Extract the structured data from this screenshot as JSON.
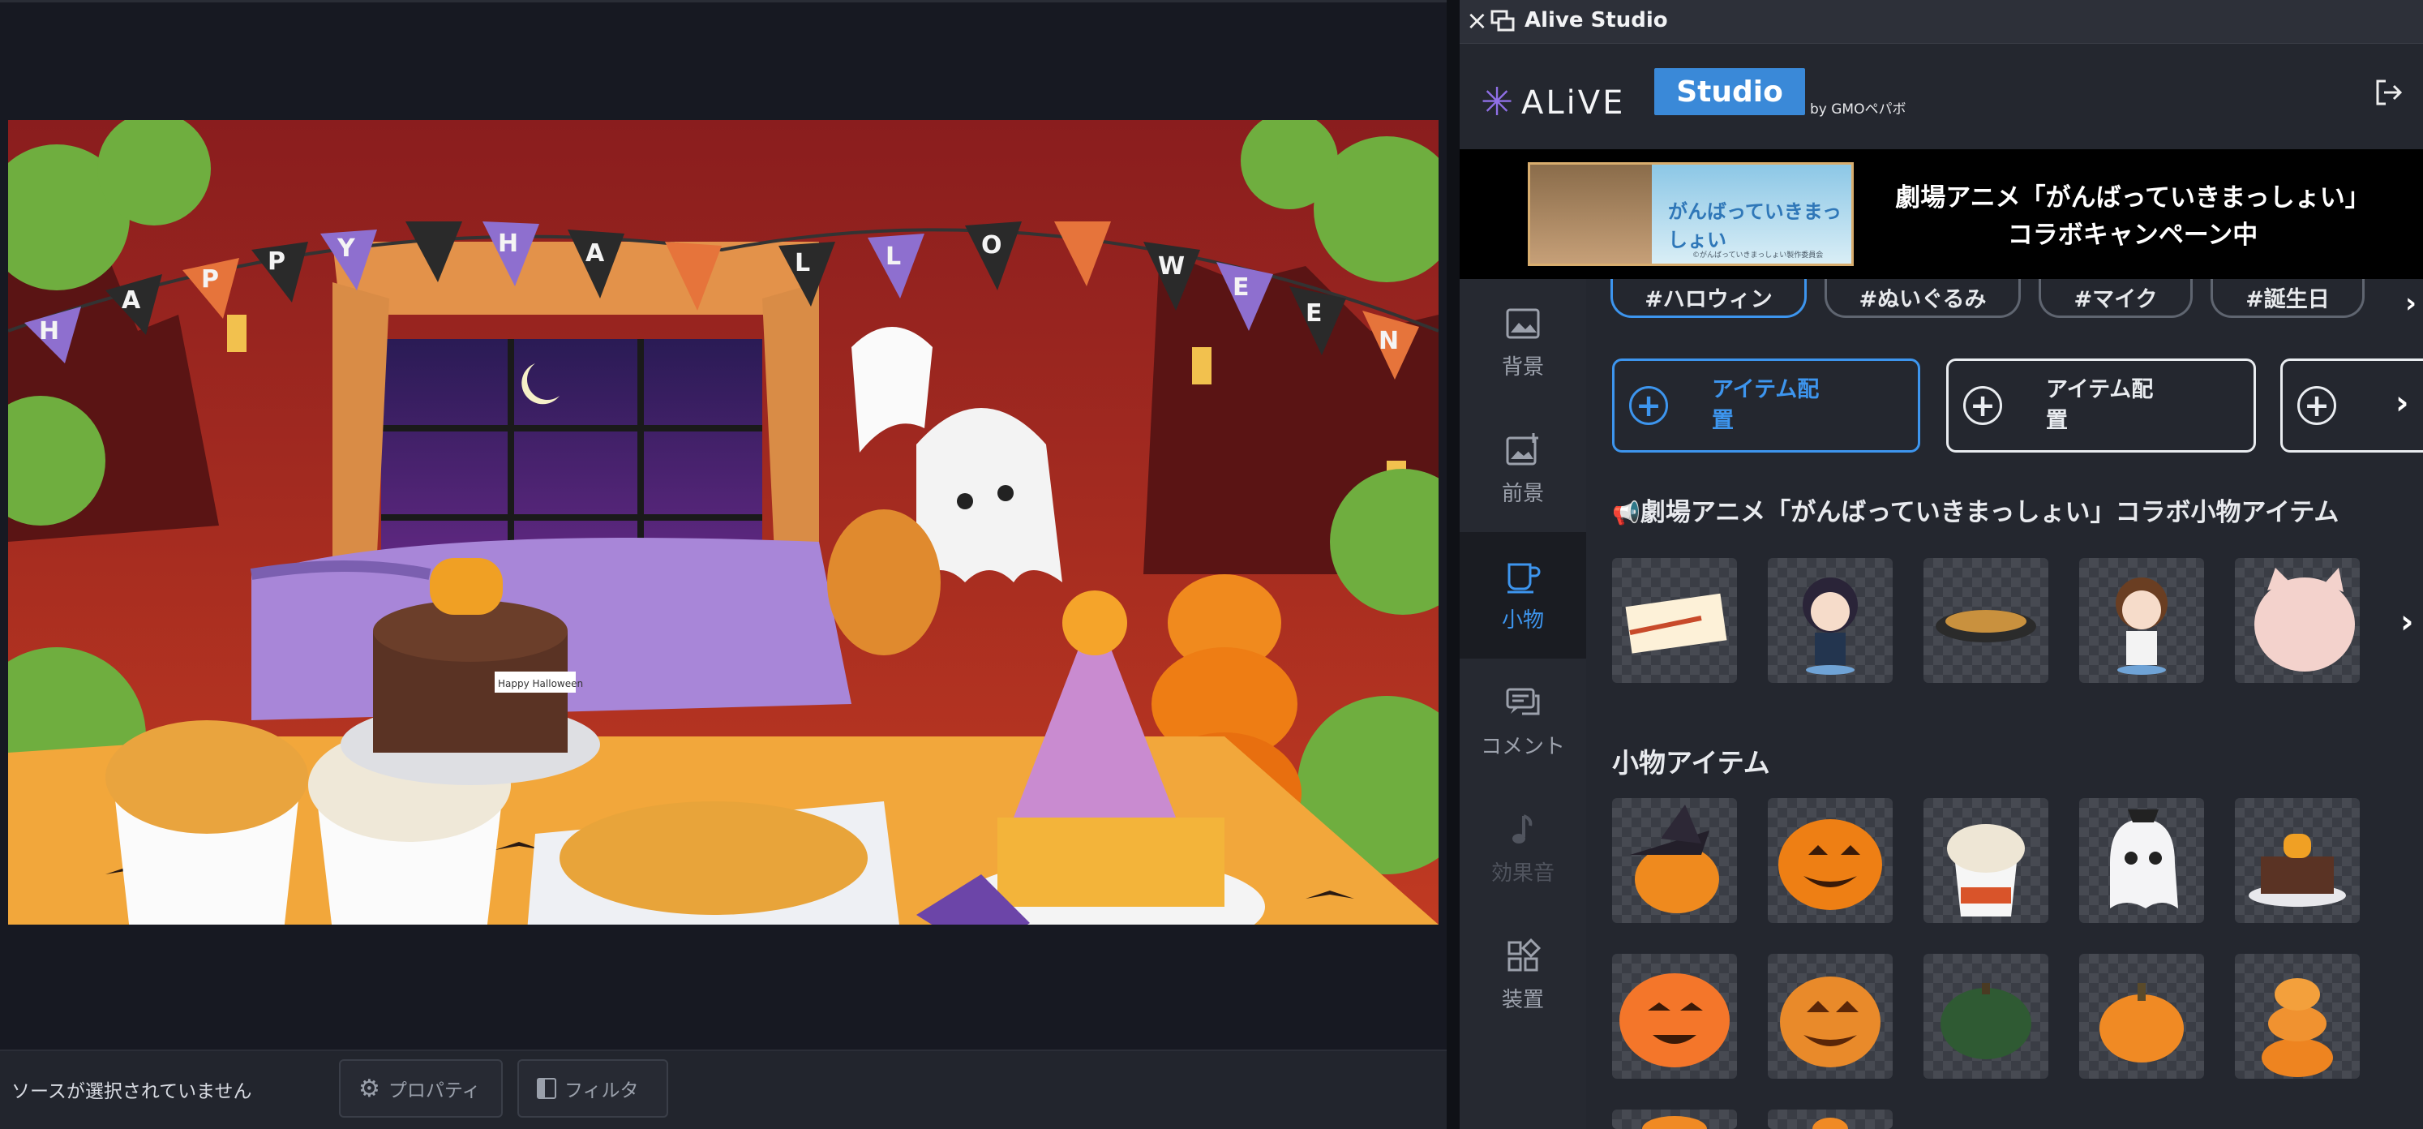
{
  "preview": {
    "bunting_letters": [
      "H",
      "A",
      "P",
      "P",
      "Y",
      "H",
      "A",
      "L",
      "L",
      "O",
      "W",
      "E",
      "E",
      "N"
    ],
    "cake_topper_text": "Happy Halloween"
  },
  "dock": {
    "status_text": "ソースが選択されていません",
    "properties_label": "プロパティ",
    "filters_label": "フィルタ"
  },
  "window": {
    "close_glyph": "×",
    "title": "Alive Studio"
  },
  "header": {
    "logo_alive": "ALiVE",
    "logo_studio": "Studio",
    "logo_by": "by GMOペパボ"
  },
  "banner": {
    "thumb_text": "がんばっていきまっしょい",
    "thumb_caption": "©がんばっていきまっしょい製作委員会",
    "line1": "劇場アニメ「がんばっていきまっしょい」",
    "line2": "コラボキャンペーン中"
  },
  "nav": {
    "items": [
      {
        "label": "背景",
        "icon": "image-icon",
        "state": "normal"
      },
      {
        "label": "前景",
        "icon": "image-plus-icon",
        "state": "normal"
      },
      {
        "label": "小物",
        "icon": "cup-icon",
        "state": "active"
      },
      {
        "label": "コメント",
        "icon": "comment-icon",
        "state": "normal"
      },
      {
        "label": "効果音",
        "icon": "music-note-icon",
        "state": "disabled"
      },
      {
        "label": "装置",
        "icon": "grid-icon",
        "state": "normal"
      }
    ]
  },
  "tags": [
    "#ハロウィン",
    "#ぬいぐるみ",
    "#マイク",
    "#誕生日"
  ],
  "tag_more": "›",
  "place_buttons": [
    {
      "label": "アイテム配置",
      "state": "active"
    },
    {
      "label": "アイテム配置",
      "state": "normal"
    },
    {
      "label": "",
      "state": "normal"
    }
  ],
  "plus_glyph": "+",
  "collab_section": {
    "title": "劇場アニメ「がんばっていきまっしょい」コラボ小物アイテム"
  },
  "small_section": {
    "title": "小物アイテム"
  },
  "colors": {
    "accent": "#3d95ee",
    "panel": "#24272f",
    "banner_bg": "#000000",
    "studio_badge": "#3a89d8",
    "logo_star": "#8f6fe6"
  }
}
